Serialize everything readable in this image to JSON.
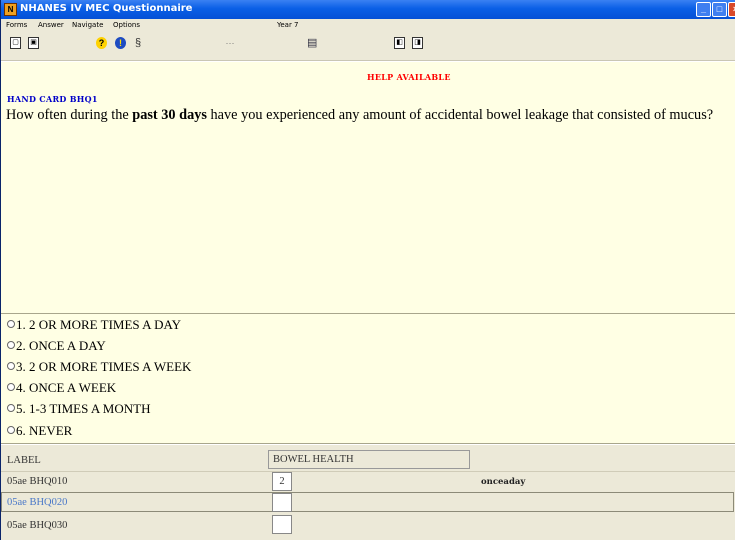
{
  "window": {
    "title": "NHANES IV MEC Questionnaire",
    "controls": {
      "minimize": "_",
      "maximize": "□",
      "close": "×"
    }
  },
  "menu": {
    "items": [
      "Forms",
      "Answer",
      "Navigate",
      "Options"
    ],
    "year": "Year 7"
  },
  "toolbar": {
    "icons": [
      "form-back-icon",
      "form-forward-icon",
      "help-icon",
      "info-icon",
      "attachment-icon",
      "more-icon",
      "document-icon",
      "previous-page-icon",
      "next-page-icon"
    ]
  },
  "question": {
    "help_text": "HELP AVAILABLE",
    "hand_card": "HAND CARD BHQ1",
    "text_before": "How often during the ",
    "text_bold": "past 30 days",
    "text_after": " have you experienced any amount of accidental bowel leakage that consisted of mucus?"
  },
  "answers": [
    {
      "label": "1. 2 OR MORE TIMES A DAY"
    },
    {
      "label": "2. ONCE A DAY"
    },
    {
      "label": "3. 2 OR MORE TIMES A WEEK"
    },
    {
      "label": "4. ONCE A WEEK"
    },
    {
      "label": "5. 1-3 TIMES A MONTH"
    },
    {
      "label": "6. NEVER"
    }
  ],
  "grid": {
    "label_header": "LABEL",
    "section": "BOWEL HEALTH",
    "rows": [
      {
        "name": "05ae BHQ010",
        "value": "2",
        "desc": "onceaday"
      },
      {
        "name": "05ae BHQ020",
        "value": "",
        "desc": ""
      },
      {
        "name": "05ae BHQ030",
        "value": "",
        "desc": ""
      }
    ]
  },
  "colors": {
    "question_bg": "#ffffe4",
    "help_text": "#ff0000",
    "hand_card": "#0000c8",
    "titlebar": "#0550d6"
  }
}
